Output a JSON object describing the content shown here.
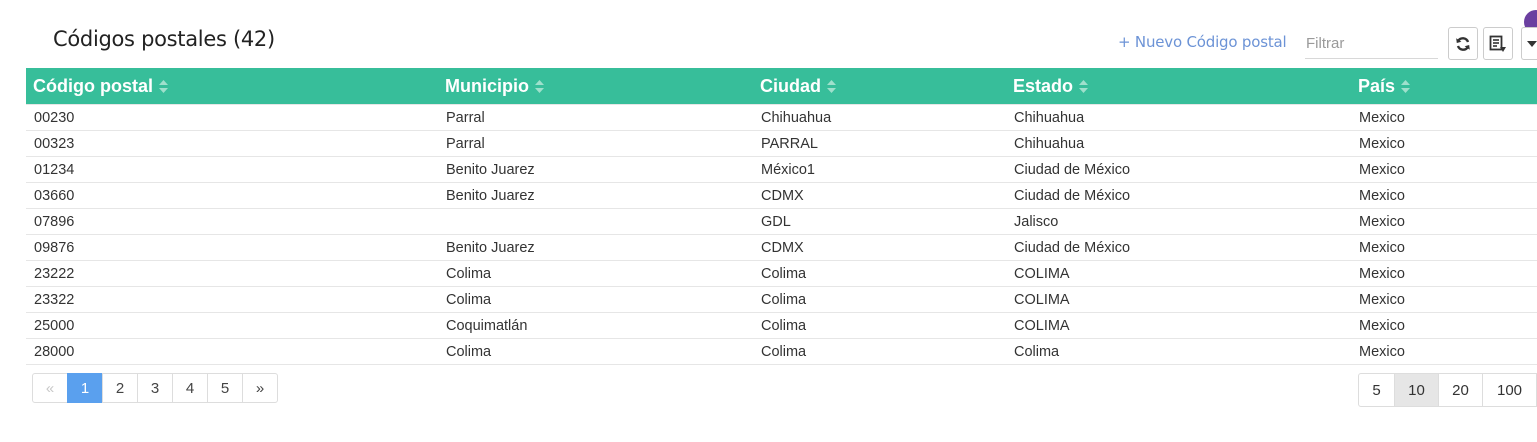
{
  "page": {
    "title": "Códigos postales (42)",
    "new_link": "+ Nuevo Código postal",
    "filter_placeholder": "Filtrar"
  },
  "toolbar": {
    "buttons": [
      {
        "name": "refresh-icon"
      },
      {
        "name": "export-icon"
      },
      {
        "name": "chevron-down-icon"
      }
    ]
  },
  "table": {
    "header_color": "#37be9a",
    "columns": [
      "Código postal",
      "Municipio",
      "Ciudad",
      "Estado",
      "País"
    ],
    "rows": [
      [
        "00230",
        "Parral",
        "Chihuahua",
        "Chihuahua",
        "Mexico"
      ],
      [
        "00323",
        "Parral",
        "PARRAL",
        "Chihuahua",
        "Mexico"
      ],
      [
        "01234",
        "Benito Juarez",
        "México1",
        "Ciudad de México",
        "Mexico"
      ],
      [
        "03660",
        "Benito Juarez",
        "CDMX",
        "Ciudad de México",
        "Mexico"
      ],
      [
        "07896",
        "",
        "GDL",
        "Jalisco",
        "Mexico"
      ],
      [
        "09876",
        "Benito Juarez",
        "CDMX",
        "Ciudad de México",
        "Mexico"
      ],
      [
        "23222",
        "Colima",
        "Colima",
        "COLIMA",
        "Mexico"
      ],
      [
        "23322",
        "Colima",
        "Colima",
        "COLIMA",
        "Mexico"
      ],
      [
        "25000",
        "Coquimatlán",
        "Colima",
        "COLIMA",
        "Mexico"
      ],
      [
        "28000",
        "Colima",
        "Colima",
        "Colima",
        "Mexico"
      ]
    ]
  },
  "pagination": {
    "items": [
      "«",
      "1",
      "2",
      "3",
      "4",
      "5",
      "»"
    ],
    "active": "1",
    "active_color": "#5aa0ee"
  },
  "page_sizes": {
    "items": [
      "5",
      "10",
      "20",
      "100"
    ],
    "active": "10"
  }
}
